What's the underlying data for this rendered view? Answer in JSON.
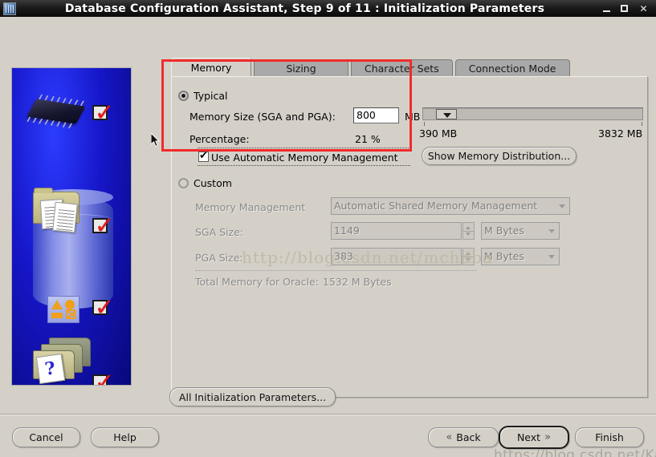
{
  "window": {
    "title": "Database Configuration Assistant, Step 9 of 11 : Initialization Parameters",
    "icon": "database-app-icon",
    "minimize_label": "_",
    "maximize_label": "",
    "close_label": "✕"
  },
  "tabs": [
    {
      "label": "Memory",
      "active": true
    },
    {
      "label": "Sizing",
      "active": false
    },
    {
      "label": "Character Sets",
      "active": false
    },
    {
      "label": "Connection Mode",
      "active": false
    }
  ],
  "typical": {
    "radio_label": "Typical",
    "selected": true,
    "memory_size_label": "Memory Size (SGA and PGA):",
    "memory_size_value": "800",
    "memory_size_unit": "MB",
    "percentage_label": "Percentage:",
    "percentage_value": "21 %",
    "auto_memory_label": "Use Automatic Memory Management",
    "auto_memory_checked": true,
    "slider_min_label": "390 MB",
    "slider_max_label": "3832 MB",
    "show_memory_distribution_label": "Show Memory Distribution..."
  },
  "custom": {
    "radio_label": "Custom",
    "selected": false,
    "memory_management_label": "Memory Management",
    "memory_management_value": "Automatic Shared Memory Management",
    "sga_size_label": "SGA Size:",
    "sga_size_value": "1149",
    "sga_size_unit": "M Bytes",
    "pga_size_label": "PGA Size:",
    "pga_size_value": "383",
    "pga_size_unit": "M Bytes",
    "total_memory_label": "Total Memory for Oracle:",
    "total_memory_value": "1532 M Bytes"
  },
  "all_params_button_label": "All Initialization Parameters...",
  "footer": {
    "cancel_label": "Cancel",
    "help_label": "Help",
    "back_label": "Back",
    "back_arrow": "«",
    "next_label": "Next",
    "next_arrow": "»",
    "finish_label": "Finish"
  },
  "watermarks": {
    "main": "http://blog.csdn.net/mchdba",
    "footer": "https://blog.csdn.net/Kamingo"
  },
  "annotation": {
    "color": "#f02b2b",
    "target": "typical-memory-group"
  },
  "side_panel": {
    "checkmarks": 4,
    "icons": [
      "memory-chip-icon",
      "folder-documents-icon",
      "database-cylinder-icon",
      "shapes-tile-icon",
      "folder-stack-question-icon"
    ]
  }
}
